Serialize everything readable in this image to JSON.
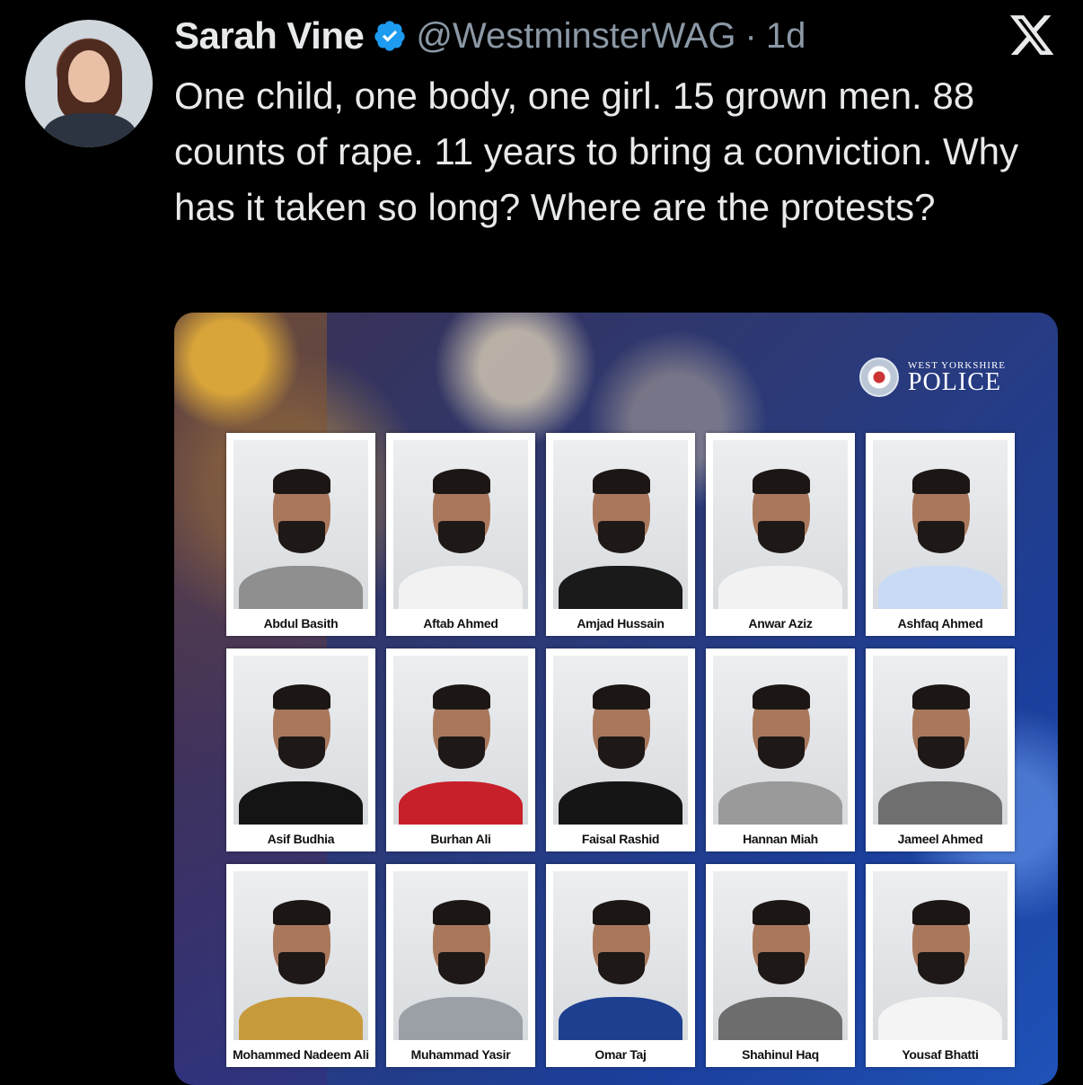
{
  "tweet": {
    "author_name": "Sarah Vine",
    "handle": "@WestminsterWAG",
    "separator": "·",
    "time": "1d",
    "text": "One child, one body, one girl. 15 grown men. 88 counts of rape. 11 years to bring a conviction. Why has it taken so long? Where are the protests?"
  },
  "colors": {
    "verified": "#1d9bf0",
    "background": "#000000",
    "muted": "#8b98a5"
  },
  "icons": {
    "verified": "verified-badge-icon",
    "platform": "x-logo-icon"
  },
  "media": {
    "police_small": "WEST YORKSHIRE",
    "police_big": "POLICE",
    "people": [
      {
        "name": "Abdul Basith",
        "shirt": "#8f8f8f"
      },
      {
        "name": "Aftab Ahmed",
        "shirt": "#f2f2f2"
      },
      {
        "name": "Amjad Hussain",
        "shirt": "#1a1a1a"
      },
      {
        "name": "Anwar Aziz",
        "shirt": "#f2f2f2"
      },
      {
        "name": "Ashfaq Ahmed",
        "shirt": "#c9daf5"
      },
      {
        "name": "Asif Budhia",
        "shirt": "#141414"
      },
      {
        "name": "Burhan Ali",
        "shirt": "#c8202a"
      },
      {
        "name": "Faisal Rashid",
        "shirt": "#151515"
      },
      {
        "name": "Hannan Miah",
        "shirt": "#9a9a9a"
      },
      {
        "name": "Jameel Ahmed",
        "shirt": "#6f6f6f"
      },
      {
        "name": "Mohammed Nadeem Ali",
        "shirt": "#c79a3b"
      },
      {
        "name": "Muhammad Yasir",
        "shirt": "#9aa0a6"
      },
      {
        "name": "Omar Taj",
        "shirt": "#1d3f8f"
      },
      {
        "name": "Shahinul Haq",
        "shirt": "#6d6d6d"
      },
      {
        "name": "Yousaf Bhatti",
        "shirt": "#f4f4f4"
      }
    ]
  }
}
